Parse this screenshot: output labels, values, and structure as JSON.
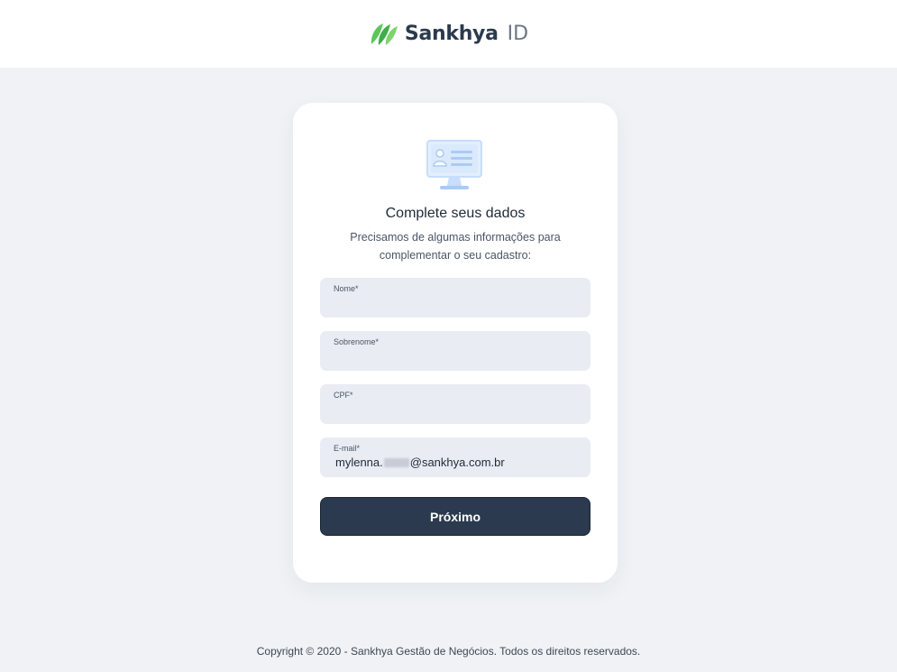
{
  "header": {
    "brand_name": "Sankhya",
    "brand_suffix": "ID",
    "logo_icon": "sankhya-leaf-logo",
    "brand_color": "#5cc65a"
  },
  "card": {
    "illustration_icon": "monitor-profile-icon",
    "title": "Complete seus dados",
    "subtitle": "Precisamos de algumas informações para complementar o seu cadastro:",
    "fields": [
      {
        "label": "Nome*",
        "value": ""
      },
      {
        "label": "Sobrenome*",
        "value": ""
      },
      {
        "label": "CPF*",
        "value": ""
      },
      {
        "label": "E-mail*",
        "value_prefix": "mylenna.",
        "value_suffix": "@sankhya.com.br"
      }
    ],
    "next_button_label": "Próximo",
    "button_color": "#2b3a4e"
  },
  "footer": {
    "copyright": "Copyright © 2020 - Sankhya Gestão de Negócios. Todos os direitos reservados."
  }
}
